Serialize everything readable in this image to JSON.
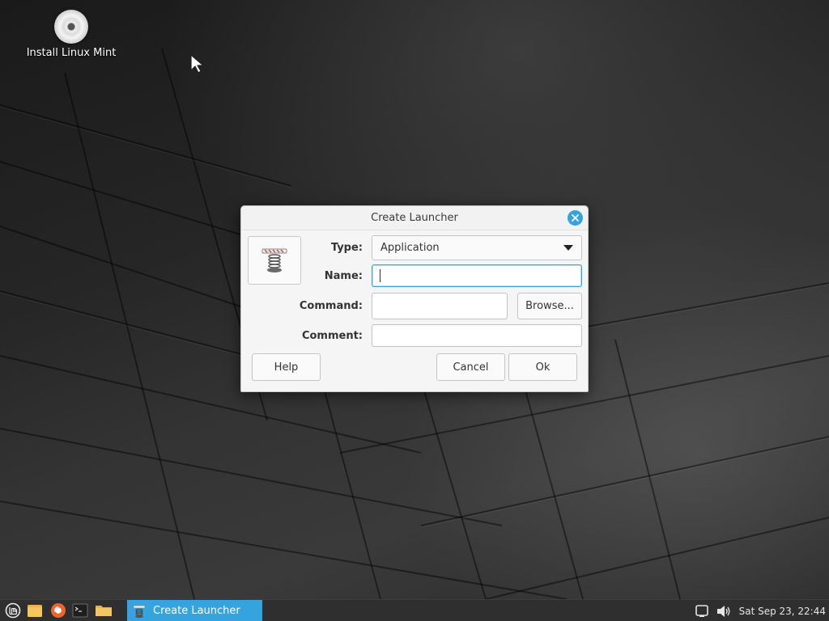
{
  "desktop": {
    "icons": [
      {
        "label": "Install Linux Mint",
        "icon": "disc-icon"
      }
    ]
  },
  "dialog": {
    "title": "Create Launcher",
    "close_icon": "close-icon",
    "launcher_icon": "launcher-spring-icon",
    "fields": {
      "type_label": "Type:",
      "type_value": "Application",
      "name_label": "Name:",
      "name_value": "",
      "command_label": "Command:",
      "command_value": "",
      "comment_label": "Comment:",
      "comment_value": ""
    },
    "buttons": {
      "browse": "Browse...",
      "help": "Help",
      "cancel": "Cancel",
      "ok": "Ok"
    }
  },
  "taskbar": {
    "launchers": [
      "menu-icon",
      "files-icon",
      "firefox-icon",
      "terminal-icon",
      "folder-icon"
    ],
    "window_title": "Create Launcher",
    "tray_icons": [
      "network-icon",
      "volume-icon"
    ],
    "clock": "Sat Sep 23, 22:44"
  },
  "colors": {
    "accent": "#35a3dd",
    "taskbar": "#2f2f2f",
    "dialog_bg": "#f5f5f5"
  }
}
